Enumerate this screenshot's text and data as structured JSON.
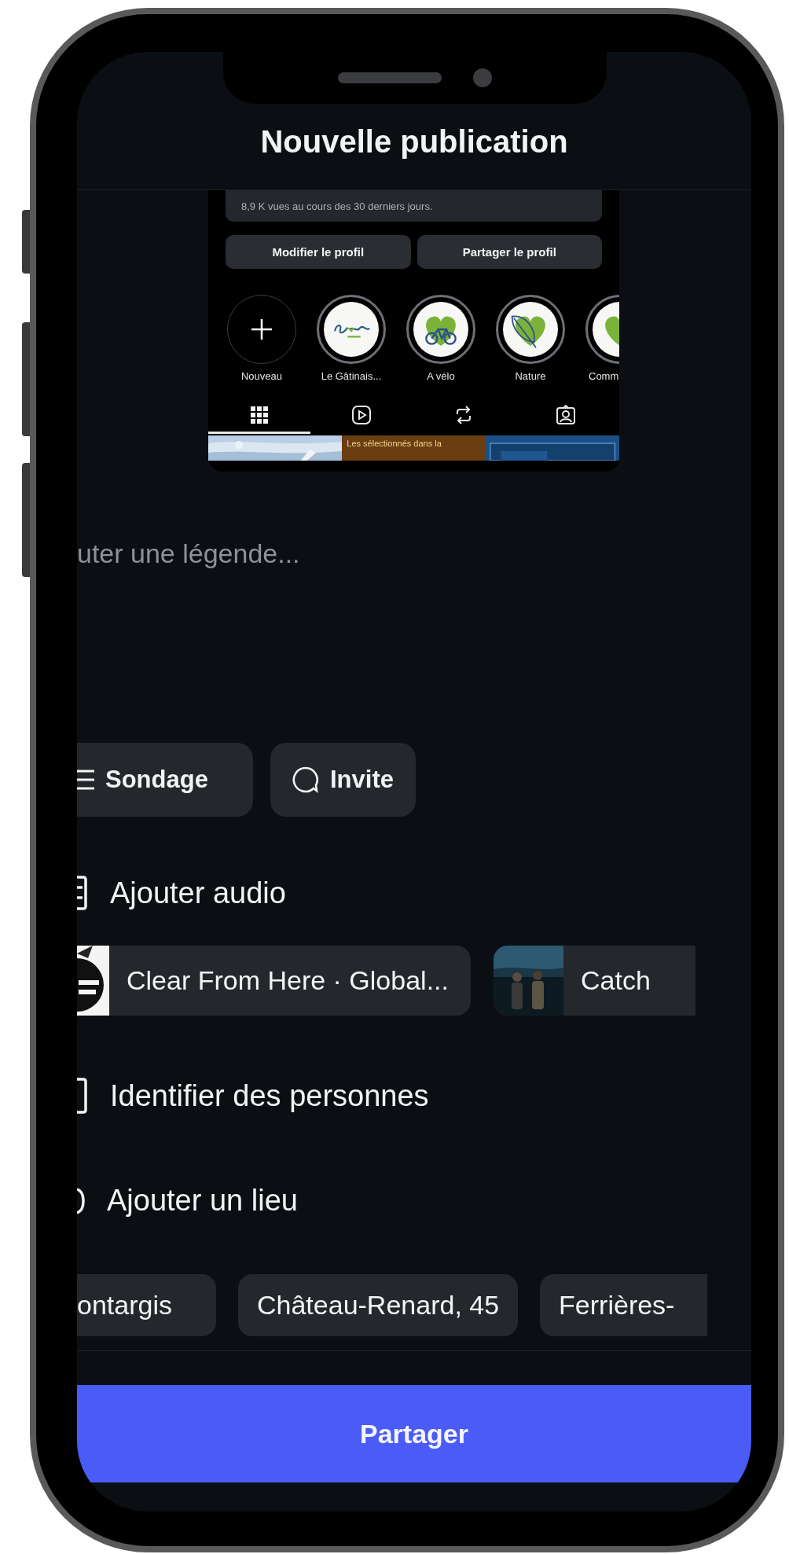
{
  "header": {
    "title": "Nouvelle publication"
  },
  "preview": {
    "stats_text": "8,9 K vues au cours des 30 derniers jours.",
    "buttons": [
      "Modifier le profil",
      "Partager le profil"
    ],
    "highlights": [
      {
        "kind": "new",
        "label": "Nouveau"
      },
      {
        "kind": "logo",
        "label": "Le Gâtinais..."
      },
      {
        "kind": "bike",
        "label": "A vélo"
      },
      {
        "kind": "leaf",
        "label": "Nature"
      },
      {
        "kind": "heart",
        "label": "Comm"
      }
    ],
    "tabs": [
      {
        "kind": "grid",
        "selected": true
      },
      {
        "kind": "reels",
        "selected": false
      },
      {
        "kind": "reposts",
        "selected": false
      },
      {
        "kind": "tagged",
        "selected": false
      }
    ],
    "thumbnails": [
      {
        "kind": "picture"
      },
      {
        "kind": "text",
        "text": "Les sélectionnés dans la"
      },
      {
        "kind": "picture"
      }
    ]
  },
  "caption": {
    "placeholder": "uter une légende..."
  },
  "chips": [
    {
      "kind": "poll",
      "label": "Sondage"
    },
    {
      "kind": "invite",
      "label": "Invite"
    }
  ],
  "audio": {
    "label": "Ajouter audio",
    "suggestions": [
      {
        "kind": "album",
        "title": "Clear From Here · Global..."
      },
      {
        "kind": "band",
        "title": "Catch"
      }
    ]
  },
  "tag_people": {
    "label": "Identifier des personnes"
  },
  "location": {
    "label": "Ajouter un lieu",
    "suggestions": [
      "ontargis",
      "Château-Renard, 45",
      "Ferrières-"
    ]
  },
  "share_button": {
    "label": "Partager"
  }
}
